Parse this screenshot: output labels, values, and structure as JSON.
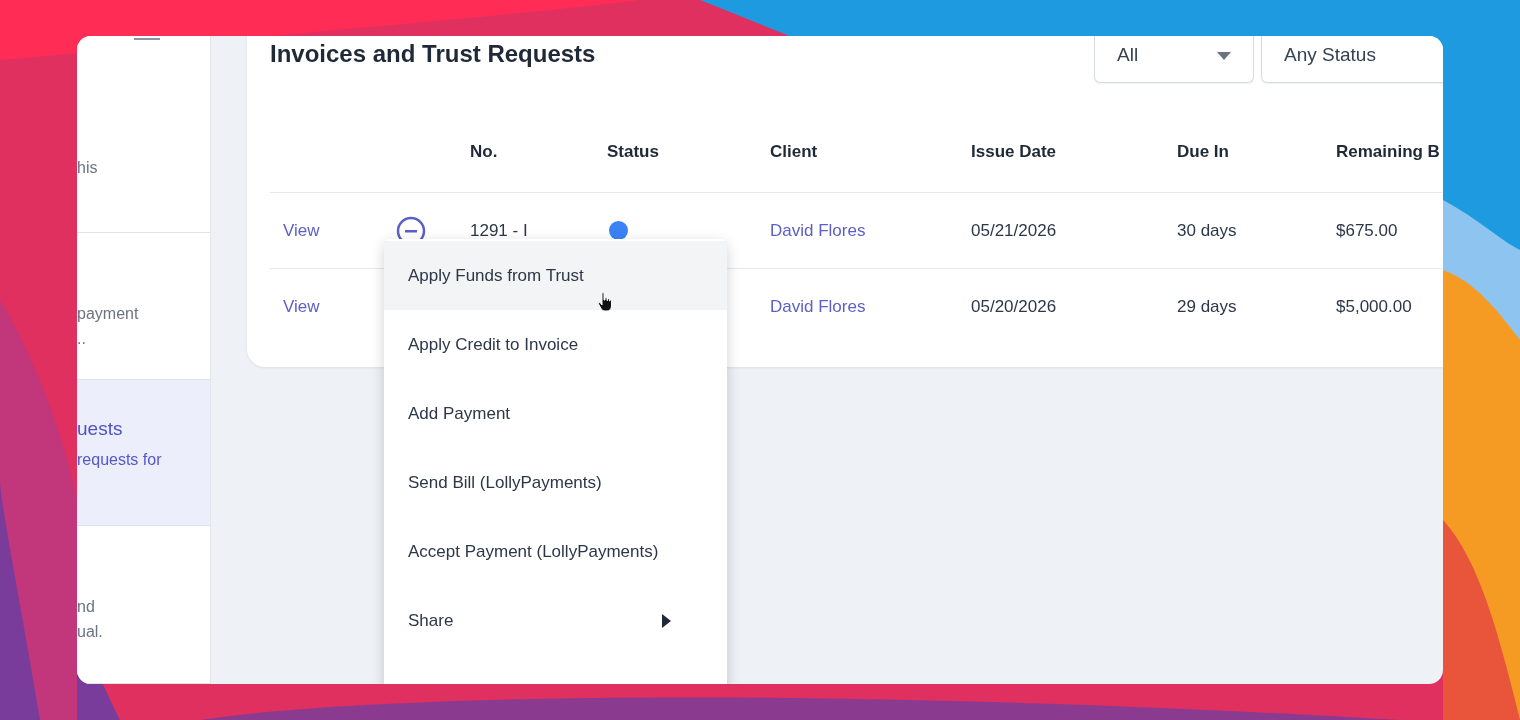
{
  "sidebar": {
    "items": [
      {
        "description": [
          "his"
        ],
        "selected": false
      },
      {
        "description": [
          "payment",
          ".."
        ],
        "selected": false
      },
      {
        "title": "uests",
        "description": [
          "requests for"
        ],
        "selected": true
      },
      {
        "description": [
          "nd",
          "ual."
        ],
        "selected": false
      }
    ]
  },
  "page_title": "Invoices and Trust Requests",
  "filters": [
    {
      "value": "All",
      "kind": "dropdown"
    },
    {
      "value": "Any Status",
      "kind": "plain"
    }
  ],
  "table": {
    "columns": [
      "No.",
      "Status",
      "Client",
      "Issue Date",
      "Due In",
      "Remaining B"
    ],
    "rows": [
      {
        "action": "View",
        "number": "1291 - I",
        "color": "#3b82f6",
        "client": "David Flores",
        "issue_date": "05/21/2026",
        "due_in": "30 days",
        "remaining": "$675.00"
      },
      {
        "action": "View",
        "client": "David Flores",
        "issue_date": "05/20/2026",
        "due_in": "29 days",
        "remaining": "$5,000.00"
      }
    ]
  },
  "context_menu": {
    "items": [
      {
        "label": "Apply Funds from Trust",
        "highlighted": true,
        "submenu": false
      },
      {
        "label": "Apply Credit to Invoice",
        "highlighted": false,
        "submenu": false
      },
      {
        "label": "Add Payment",
        "highlighted": false,
        "submenu": false
      },
      {
        "label": "Send Bill (LollyPayments)",
        "highlighted": false,
        "submenu": false
      },
      {
        "label": "Accept Payment (LollyPayments)",
        "highlighted": false,
        "submenu": false
      },
      {
        "label": "Share",
        "highlighted": false,
        "submenu": true
      }
    ]
  }
}
